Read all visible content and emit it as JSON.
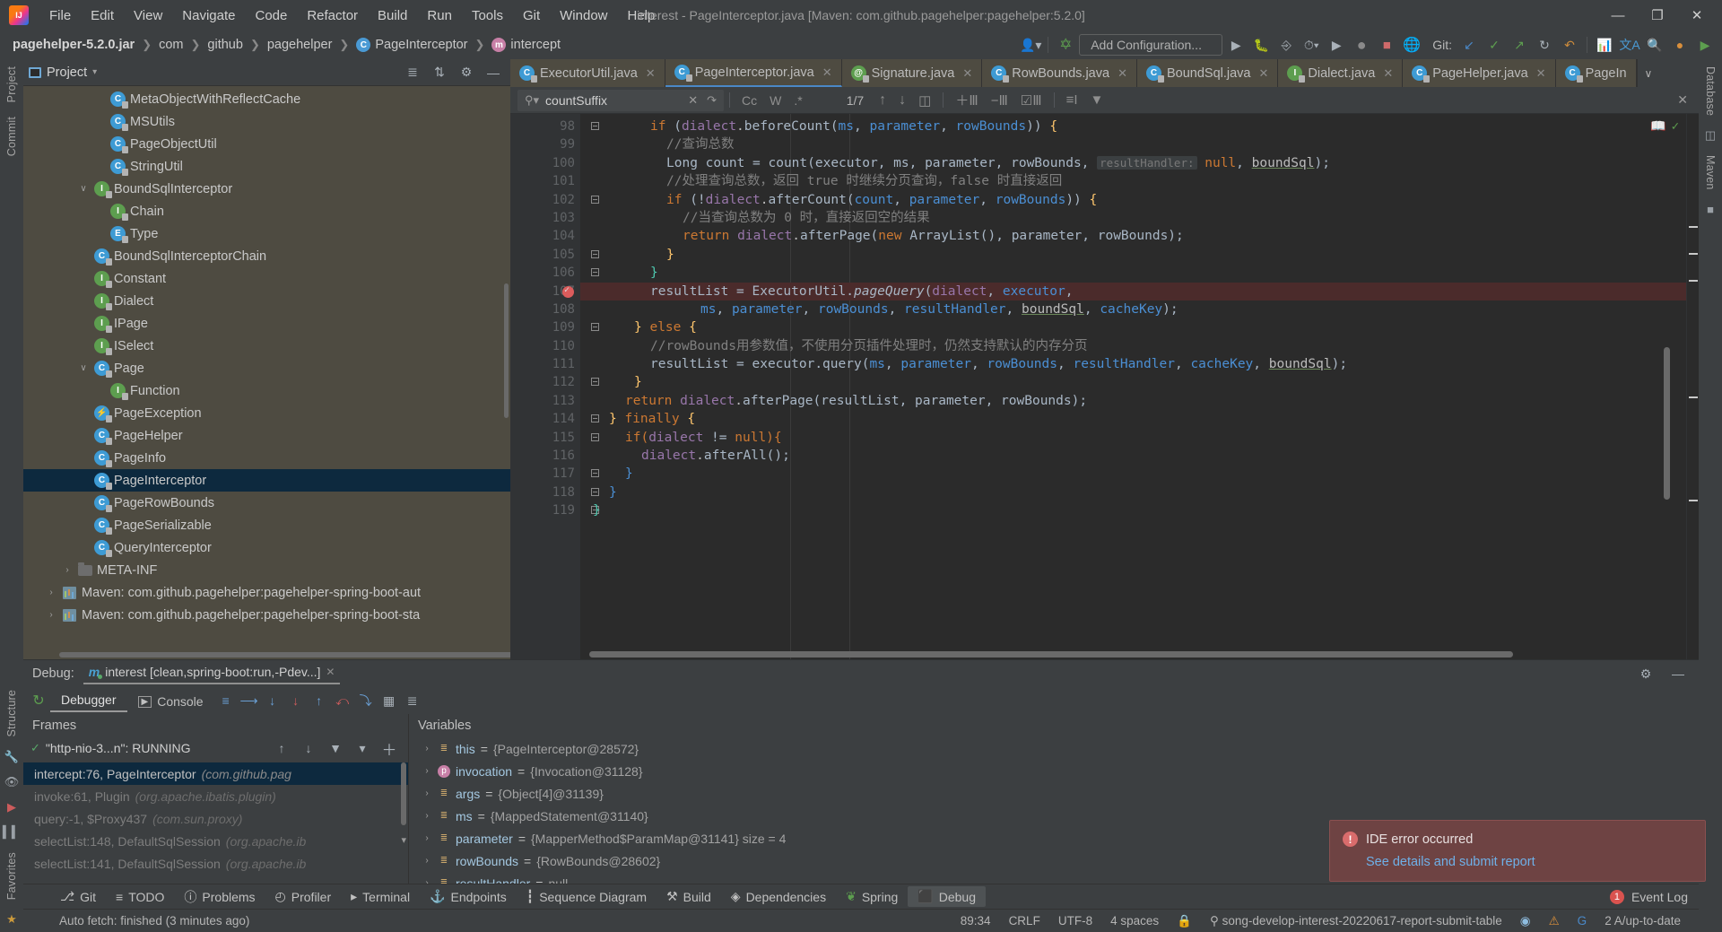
{
  "window": {
    "title": "interest - PageInterceptor.java [Maven: com.github.pagehelper:pagehelper:5.2.0]",
    "minimize": "—",
    "maximize": "❐",
    "close": "✕"
  },
  "menu": {
    "items": [
      "File",
      "Edit",
      "View",
      "Navigate",
      "Code",
      "Refactor",
      "Build",
      "Run",
      "Tools",
      "Git",
      "Window",
      "Help"
    ]
  },
  "navbar": {
    "breadcrumbs": [
      {
        "label": "pagehelper-5.2.0.jar",
        "icon": "",
        "bold": true
      },
      {
        "label": "com",
        "icon": ""
      },
      {
        "label": "github",
        "icon": ""
      },
      {
        "label": "pagehelper",
        "icon": ""
      },
      {
        "label": "PageInterceptor",
        "icon": "class-icon"
      },
      {
        "label": "intercept",
        "icon": "method-icon"
      }
    ],
    "run_config": "Add Configuration...",
    "git_label": "Git:",
    "icons": [
      "user-icon",
      "build-icon",
      "run-icon",
      "debug-icon",
      "run-coverage-icon",
      "profile-icon",
      "more-run-icon",
      "run2-icon",
      "record-icon",
      "stop-icon",
      "search-everywhere-icon",
      "settings-icon",
      "notifications-icon"
    ]
  },
  "project": {
    "title": "Project",
    "tree": [
      {
        "label": "MetaObjectWithReflectCache",
        "icon": "class-icon",
        "indent": 4,
        "arrow": ""
      },
      {
        "label": "MSUtils",
        "icon": "class-icon",
        "indent": 4,
        "arrow": ""
      },
      {
        "label": "PageObjectUtil",
        "icon": "class-icon",
        "indent": 4,
        "arrow": ""
      },
      {
        "label": "StringUtil",
        "icon": "class-icon",
        "indent": 4,
        "arrow": ""
      },
      {
        "label": "BoundSqlInterceptor",
        "icon": "interface-icon",
        "indent": 3,
        "arrow": "∨"
      },
      {
        "label": "Chain",
        "icon": "interface-icon",
        "indent": 4,
        "arrow": ""
      },
      {
        "label": "Type",
        "icon": "enum-icon",
        "indent": 4,
        "arrow": ""
      },
      {
        "label": "BoundSqlInterceptorChain",
        "icon": "class-icon",
        "indent": 3,
        "arrow": ""
      },
      {
        "label": "Constant",
        "icon": "interface-icon",
        "indent": 3,
        "arrow": ""
      },
      {
        "label": "Dialect",
        "icon": "interface-icon",
        "indent": 3,
        "arrow": ""
      },
      {
        "label": "IPage",
        "icon": "interface-icon",
        "indent": 3,
        "arrow": ""
      },
      {
        "label": "ISelect",
        "icon": "interface-icon",
        "indent": 3,
        "arrow": ""
      },
      {
        "label": "Page",
        "icon": "class-icon",
        "indent": 3,
        "arrow": "∨"
      },
      {
        "label": "Function",
        "icon": "interface-icon",
        "indent": 4,
        "arrow": ""
      },
      {
        "label": "PageException",
        "icon": "exception-icon",
        "indent": 3,
        "arrow": ""
      },
      {
        "label": "PageHelper",
        "icon": "class-icon",
        "indent": 3,
        "arrow": ""
      },
      {
        "label": "PageInfo",
        "icon": "class-icon",
        "indent": 3,
        "arrow": ""
      },
      {
        "label": "PageInterceptor",
        "icon": "class-icon",
        "indent": 3,
        "arrow": "",
        "selected": true
      },
      {
        "label": "PageRowBounds",
        "icon": "class-icon",
        "indent": 3,
        "arrow": ""
      },
      {
        "label": "PageSerializable",
        "icon": "class-icon",
        "indent": 3,
        "arrow": ""
      },
      {
        "label": "QueryInterceptor",
        "icon": "class-icon",
        "indent": 3,
        "arrow": ""
      },
      {
        "label": "META-INF",
        "icon": "folder-icon",
        "indent": 2,
        "arrow": "›"
      },
      {
        "label": "Maven: com.github.pagehelper:pagehelper-spring-boot-aut",
        "icon": "maven-icon",
        "indent": 1,
        "arrow": "›"
      },
      {
        "label": "Maven: com.github.pagehelper:pagehelper-spring-boot-sta",
        "icon": "maven-icon",
        "indent": 1,
        "arrow": "›"
      }
    ]
  },
  "editor": {
    "tabs": [
      {
        "label": "ExecutorUtil.java",
        "icon": "class-icon",
        "active": false
      },
      {
        "label": "PageInterceptor.java",
        "icon": "class-icon",
        "active": true
      },
      {
        "label": "Signature.java",
        "icon": "annotation-icon",
        "active": false
      },
      {
        "label": "RowBounds.java",
        "icon": "class-icon",
        "active": false
      },
      {
        "label": "BoundSql.java",
        "icon": "class-icon",
        "active": false
      },
      {
        "label": "Dialect.java",
        "icon": "interface-icon",
        "active": false
      },
      {
        "label": "PageHelper.java",
        "icon": "class-icon",
        "active": false
      },
      {
        "label": "PageIn",
        "icon": "class-icon",
        "active": false
      }
    ],
    "tabs_more": "∨",
    "find": {
      "query": "countSuffix",
      "match_count": "1/7",
      "options": [
        "Cc",
        "W",
        ".*"
      ],
      "icons": [
        "search-dropdown-icon",
        "clear-icon",
        "history-icon",
        "prev-match-icon",
        "next-match-icon",
        "select-all-icon",
        "add-selection-icon",
        "remove-selection-icon",
        "select-occurrences-icon",
        "filter-lines-icon",
        "filter-icon",
        "close-find-icon"
      ]
    },
    "lines": [
      {
        "num": "98",
        "fold": true,
        "bp": false,
        "hl": false
      },
      {
        "num": "99",
        "fold": false,
        "bp": false,
        "hl": false
      },
      {
        "num": "100",
        "fold": false,
        "bp": false,
        "hl": false
      },
      {
        "num": "101",
        "fold": false,
        "bp": false,
        "hl": false
      },
      {
        "num": "102",
        "fold": true,
        "bp": false,
        "hl": false
      },
      {
        "num": "103",
        "fold": false,
        "bp": false,
        "hl": false
      },
      {
        "num": "104",
        "fold": false,
        "bp": false,
        "hl": false
      },
      {
        "num": "105",
        "fold": true,
        "bp": false,
        "hl": false
      },
      {
        "num": "106",
        "fold": true,
        "bp": false,
        "hl": false
      },
      {
        "num": "107",
        "fold": false,
        "bp": true,
        "hl": true
      },
      {
        "num": "108",
        "fold": false,
        "bp": false,
        "hl": false
      },
      {
        "num": "109",
        "fold": true,
        "bp": false,
        "hl": false
      },
      {
        "num": "110",
        "fold": false,
        "bp": false,
        "hl": false
      },
      {
        "num": "111",
        "fold": false,
        "bp": false,
        "hl": false
      },
      {
        "num": "112",
        "fold": true,
        "bp": false,
        "hl": false
      },
      {
        "num": "113",
        "fold": false,
        "bp": false,
        "hl": false
      },
      {
        "num": "114",
        "fold": true,
        "bp": false,
        "hl": false
      },
      {
        "num": "115",
        "fold": true,
        "bp": false,
        "hl": false
      },
      {
        "num": "116",
        "fold": false,
        "bp": false,
        "hl": false
      },
      {
        "num": "117",
        "fold": true,
        "bp": false,
        "hl": false
      },
      {
        "num": "118",
        "fold": true,
        "bp": false,
        "hl": false
      },
      {
        "num": "119",
        "fold": true,
        "bp": false,
        "hl": false
      }
    ],
    "code": {
      "l98": "if (dialect.beforeCount(ms, parameter, rowBounds)) {",
      "l99": "//查询总数",
      "l100a": "Long count = count(executor, ms, parameter, rowBounds,",
      "l100hint": "resultHandler:",
      "l100b": "null, boundSql);",
      "l101": "//处理查询总数，返回 true 时继续分页查询，false 时直接返回",
      "l102": "if (!dialect.afterCount(count, parameter, rowBounds)) {",
      "l103": "//当查询总数为 0 时，直接返回空的结果",
      "l104": "return dialect.afterPage(new ArrayList(), parameter, rowBounds);",
      "l105": "}",
      "l106": "}",
      "l107": "resultList = ExecutorUtil.pageQuery(dialect, executor,",
      "l108": "ms, parameter, rowBounds, resultHandler, boundSql, cacheKey);",
      "l109": "} else {",
      "l110": "//rowBounds用参数值，不使用分页插件处理时，仍然支持默认的内存分页",
      "l111": "resultList = executor.query(ms, parameter, rowBounds, resultHandler, cacheKey, boundSql);",
      "l112": "}",
      "l113": "return dialect.afterPage(resultList, parameter, rowBounds);",
      "l114": "} finally {",
      "l115": "if(dialect != null){",
      "l116": "dialect.afterAll();",
      "l117": "}",
      "l118": "}",
      "l119": "}"
    }
  },
  "debug": {
    "label": "Debug:",
    "config": "interest [clean,spring-boot:run,-Pdev...]",
    "config_close": "✕",
    "tabs": [
      {
        "label": "Debugger",
        "active": true
      },
      {
        "label": "Console",
        "active": false
      }
    ],
    "toolbar_icons": [
      "rerun-icon",
      "layout-icon",
      "step-over-icon",
      "step-into-icon",
      "force-step-into-icon",
      "step-out-icon",
      "drop-frame-icon",
      "run-to-cursor-icon",
      "evaluate-icon",
      "settings2-icon"
    ],
    "frames": {
      "title": "Frames",
      "thread": "\"http-nio-3...n\": RUNNING",
      "thread_icons": [
        "up-icon",
        "down-icon",
        "filter-icon",
        "chevron-down-icon",
        "add-icon",
        "remove-icon"
      ],
      "items": [
        {
          "method": "intercept:76, PageInterceptor",
          "pkg": "(com.github.pag",
          "selected": true
        },
        {
          "method": "invoke:61, Plugin",
          "pkg": "(org.apache.ibatis.plugin)",
          "selected": false
        },
        {
          "method": "query:-1, $Proxy437",
          "pkg": "(com.sun.proxy)",
          "selected": false
        },
        {
          "method": "selectList:148, DefaultSqlSession",
          "pkg": "(org.apache.ib",
          "selected": false
        },
        {
          "method": "selectList:141, DefaultSqlSession",
          "pkg": "(org.apache.ib",
          "selected": false
        }
      ]
    },
    "variables": {
      "title": "Variables",
      "items": [
        {
          "arrow": "›",
          "icon": "list-icon",
          "name": "this",
          "eq": "=",
          "value": "{PageInterceptor@28572}"
        },
        {
          "arrow": "›",
          "icon": "param-icon",
          "name": "invocation",
          "eq": "=",
          "value": "{Invocation@31128}"
        },
        {
          "arrow": "›",
          "icon": "list-icon",
          "name": "args",
          "eq": "=",
          "value": "{Object[4]@31139}"
        },
        {
          "arrow": "›",
          "icon": "list-icon",
          "name": "ms",
          "eq": "=",
          "value": "{MappedStatement@31140}"
        },
        {
          "arrow": "›",
          "icon": "list-icon",
          "name": "parameter",
          "eq": "=",
          "value": "{MapperMethod$ParamMap@31141} size = 4"
        },
        {
          "arrow": "›",
          "icon": "list-icon",
          "name": "rowBounds",
          "eq": "=",
          "value": "{RowBounds@28602}"
        },
        {
          "arrow": "›",
          "icon": "list-icon",
          "name": "resultHandler",
          "eq": "=",
          "value": "null"
        }
      ]
    }
  },
  "notification": {
    "title": "IDE error occurred",
    "link": "See details and submit report",
    "icon": "error-icon"
  },
  "toolwindows": {
    "items": [
      {
        "label": "Git",
        "icon": "git-icon",
        "active": false
      },
      {
        "label": "TODO",
        "icon": "todo-icon",
        "active": false
      },
      {
        "label": "Problems",
        "icon": "problems-icon",
        "active": false
      },
      {
        "label": "Profiler",
        "icon": "profiler-icon",
        "active": false
      },
      {
        "label": "Terminal",
        "icon": "terminal-icon",
        "active": false
      },
      {
        "label": "Endpoints",
        "icon": "endpoints-icon",
        "active": false
      },
      {
        "label": "Sequence Diagram",
        "icon": "sequence-icon",
        "active": false
      },
      {
        "label": "Build",
        "icon": "build-icon",
        "active": false
      },
      {
        "label": "Dependencies",
        "icon": "dependencies-icon",
        "active": false
      },
      {
        "label": "Spring",
        "icon": "spring-icon",
        "active": false
      },
      {
        "label": "Debug",
        "icon": "debug-icon",
        "active": true
      }
    ],
    "event_log": "Event Log",
    "event_count": "1"
  },
  "statusbar": {
    "message": "Auto fetch: finished (3 minutes ago)",
    "caret": "89:34",
    "line_sep": "CRLF",
    "encoding": "UTF-8",
    "indent": "4 spaces",
    "branch": "song-develop-interest-20220617-report-submit-table",
    "updates": "2 A/up-to-date",
    "icons": [
      "lock-icon",
      "inspection-icon",
      "google-icon",
      "memory-icon"
    ]
  },
  "sidestrips": {
    "left_top": [
      "Project",
      "Commit"
    ],
    "left_bottom": [
      "Structure",
      "Favorites"
    ],
    "right_top": [
      "Database",
      "Maven"
    ]
  },
  "colors": {
    "accent": "#4a88c7",
    "selection": "#0d293e",
    "tree_bg": "#4e4b41",
    "editor_bg": "#2b2b2b",
    "chrome": "#3c3f41",
    "error": "#6e4343",
    "breakpoint": "#db5c5c"
  }
}
